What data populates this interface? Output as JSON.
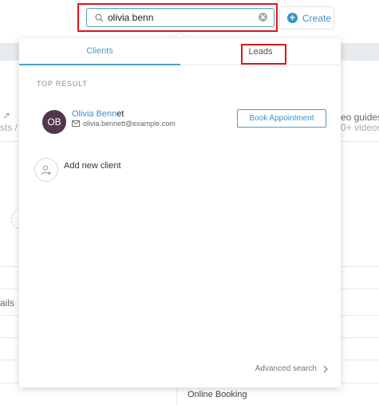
{
  "search": {
    "value": "olivia benn"
  },
  "header": {
    "create_label": "Create"
  },
  "dropdown": {
    "tabs": [
      {
        "label": "Clients"
      },
      {
        "label": "Leads"
      }
    ],
    "top_result_label": "TOP RESULT",
    "result": {
      "initials": "OB",
      "name_match": "Olivia Benn",
      "name_rest": "et",
      "email": "olivia.bennett@example.com",
      "book_label": "Book Appointment"
    },
    "add_client_label": "Add new client",
    "advanced_search_label": "Advanced search"
  },
  "background": {
    "eo_guides": "eo guides",
    "videos": "0+ videos",
    "sts": "sts / ",
    "ails": "ails",
    "online_booking": "Online Booking"
  },
  "colors": {
    "accent": "#4aa3c2",
    "link": "#3a93c9",
    "highlight": "#e0151d",
    "avatar": "#52384f"
  }
}
